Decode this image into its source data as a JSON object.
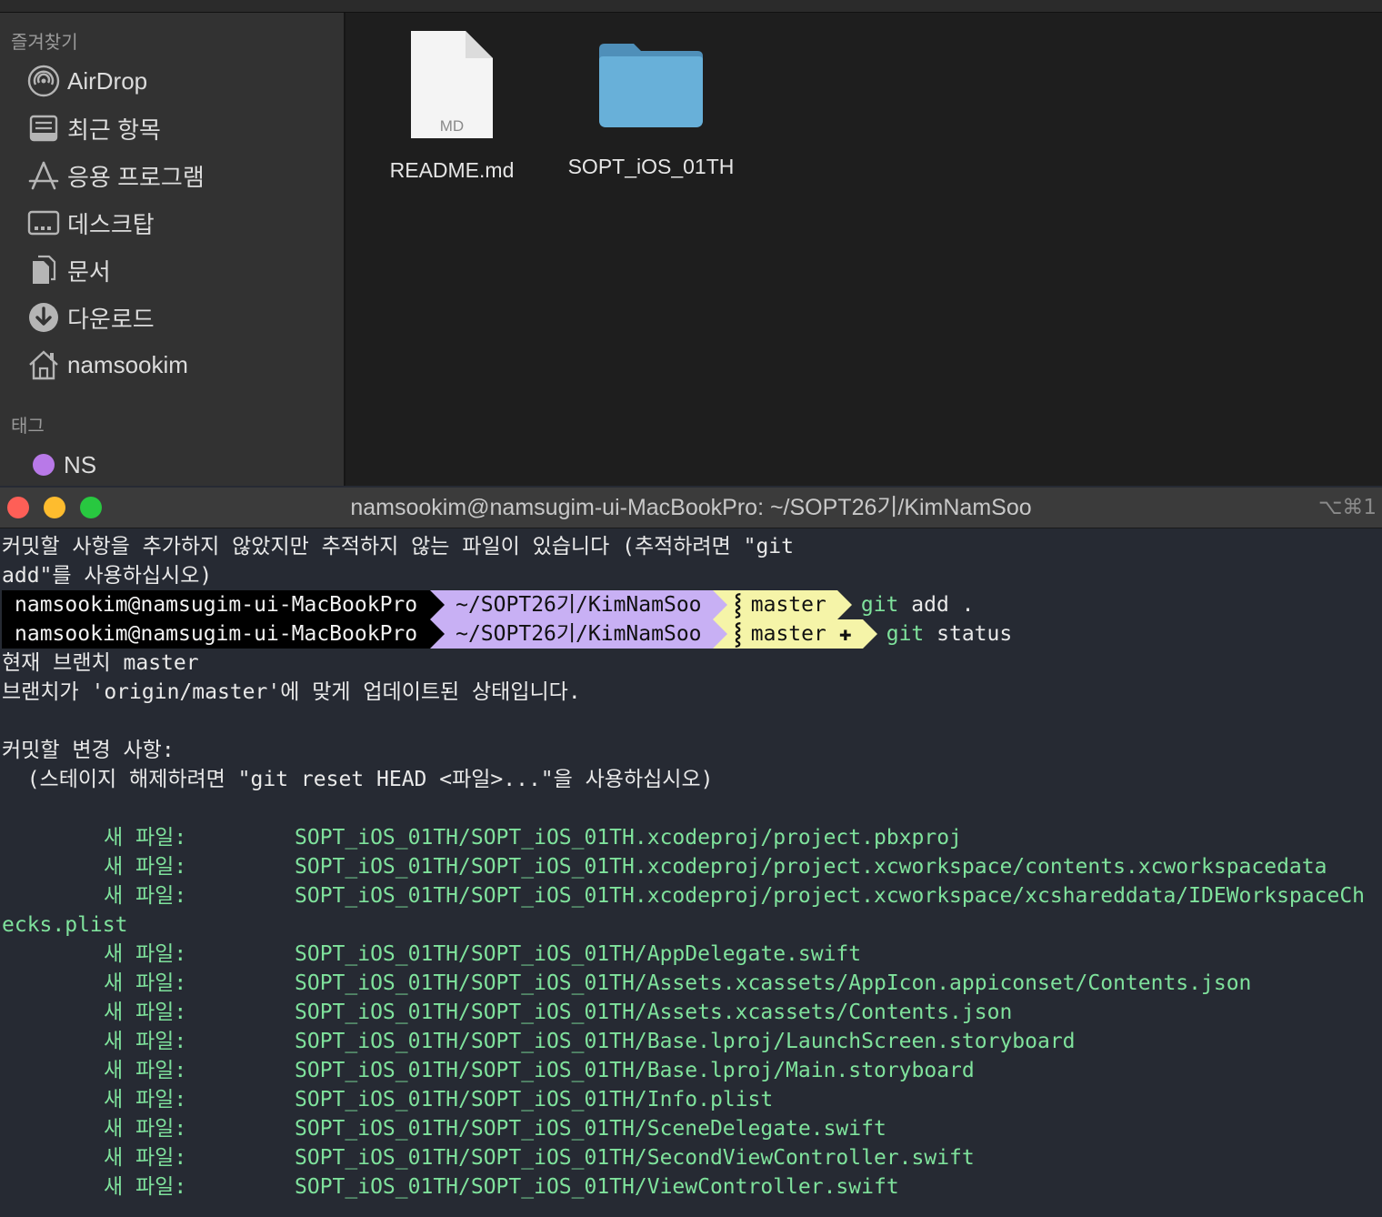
{
  "finder": {
    "sidebar": {
      "favorites_title": "즐겨찾기",
      "items": [
        {
          "label": "AirDrop",
          "icon": "airdrop-icon"
        },
        {
          "label": "최근 항목",
          "icon": "recents-icon"
        },
        {
          "label": "응용 프로그램",
          "icon": "applications-icon"
        },
        {
          "label": "데스크탑",
          "icon": "desktop-icon"
        },
        {
          "label": "문서",
          "icon": "documents-icon"
        },
        {
          "label": "다운로드",
          "icon": "downloads-icon"
        },
        {
          "label": "namsookim",
          "icon": "home-icon"
        }
      ],
      "tags_title": "태그",
      "tags": [
        {
          "label": "NS",
          "color": "#b879e8"
        }
      ]
    },
    "files": [
      {
        "name": "README.md",
        "type_badge": "MD",
        "icon": "markdown-file-icon"
      },
      {
        "name": "SOPT_iOS_01TH",
        "icon": "folder-icon"
      }
    ]
  },
  "terminal": {
    "title": "namsookim@namsugim-ui-MacBookPro: ~/SOPT26기/KimNamSoo",
    "shortcut": "⌥⌘1",
    "intro_lines": [
      "커밋할 사항을 추가하지 않았지만 추적하지 않는 파일이 있습니다 (추적하려면 \"git",
      "add\"를 사용하십시오)"
    ],
    "prompts": [
      {
        "user": "namsookim@namsugim-ui-MacBookPro",
        "path": "~/SOPT26기/KimNamSoo",
        "branch": "master",
        "dirty": "",
        "command": "git",
        "args": "add ."
      },
      {
        "user": "namsookim@namsugim-ui-MacBookPro",
        "path": "~/SOPT26기/KimNamSoo",
        "branch": "master",
        "dirty": "✚",
        "command": "git",
        "args": "status"
      }
    ],
    "status_lines": [
      "현재 브랜치 master",
      "브랜치가 'origin/master'에 맞게 업데이트된 상태입니다.",
      "",
      "커밋할 변경 사항:",
      "  (스테이지 해제하려면 \"git reset HEAD <파일>...\"을 사용하십시오)",
      ""
    ],
    "new_file_label": "새 파일:",
    "new_files": [
      "SOPT_iOS_01TH/SOPT_iOS_01TH.xcodeproj/project.pbxproj",
      "SOPT_iOS_01TH/SOPT_iOS_01TH.xcodeproj/project.xcworkspace/contents.xcworkspacedata",
      "SOPT_iOS_01TH/SOPT_iOS_01TH.xcodeproj/project.xcworkspace/xcshareddata/IDEWorkspaceCh",
      "SOPT_iOS_01TH/SOPT_iOS_01TH/AppDelegate.swift",
      "SOPT_iOS_01TH/SOPT_iOS_01TH/Assets.xcassets/AppIcon.appiconset/Contents.json",
      "SOPT_iOS_01TH/SOPT_iOS_01TH/Assets.xcassets/Contents.json",
      "SOPT_iOS_01TH/SOPT_iOS_01TH/Base.lproj/LaunchScreen.storyboard",
      "SOPT_iOS_01TH/SOPT_iOS_01TH/Base.lproj/Main.storyboard",
      "SOPT_iOS_01TH/SOPT_iOS_01TH/Info.plist",
      "SOPT_iOS_01TH/SOPT_iOS_01TH/SceneDelegate.swift",
      "SOPT_iOS_01TH/SOPT_iOS_01TH/SecondViewController.swift",
      "SOPT_iOS_01TH/SOPT_iOS_01TH/ViewController.swift"
    ],
    "wrapped_continuation": "ecks.plist"
  }
}
